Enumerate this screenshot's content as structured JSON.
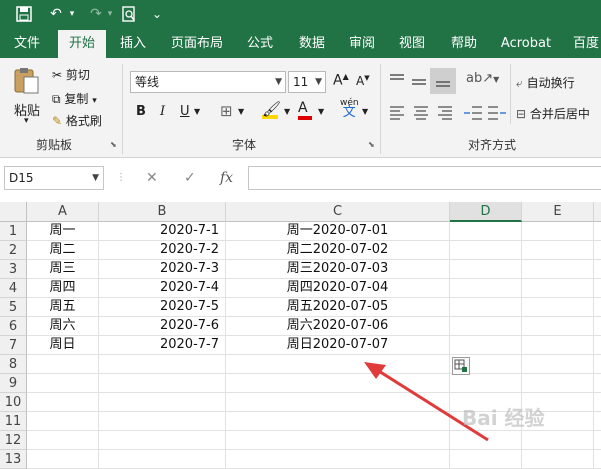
{
  "qat": {
    "undo": "↶",
    "redo": "↷",
    "save": "🖫",
    "preview": "🗋",
    "more": "⌄"
  },
  "tabs": [
    "文件",
    "开始",
    "插入",
    "页面布局",
    "公式",
    "数据",
    "审阅",
    "视图",
    "帮助",
    "Acrobat",
    "百度"
  ],
  "ribbon": {
    "clipboard": {
      "paste": "粘贴",
      "cut": "剪切",
      "copy": "复制",
      "format_painter": "格式刷",
      "label": "剪贴板"
    },
    "font": {
      "name": "等线",
      "size": "11",
      "bold": "B",
      "italic": "I",
      "underline": "U",
      "grow": "A",
      "shrink": "A",
      "label": "字体",
      "wen": "wén",
      "wen2": "文"
    },
    "align": {
      "wrap": "自动换行",
      "merge": "合并后居中",
      "label": "对齐方式"
    }
  },
  "formula_bar": {
    "name_box": "D15",
    "cancel": "✕",
    "enter": "✓",
    "fx": "fx",
    "value": ""
  },
  "columns": [
    "A",
    "B",
    "C",
    "D",
    "E"
  ],
  "selected_column": "D",
  "rows": [
    {
      "n": "1",
      "a": "周一",
      "b": "2020-7-1",
      "c": "周一2020-07-01"
    },
    {
      "n": "2",
      "a": "周二",
      "b": "2020-7-2",
      "c": "周二2020-07-02"
    },
    {
      "n": "3",
      "a": "周三",
      "b": "2020-7-3",
      "c": "周三2020-07-03"
    },
    {
      "n": "4",
      "a": "周四",
      "b": "2020-7-4",
      "c": "周四2020-07-04"
    },
    {
      "n": "5",
      "a": "周五",
      "b": "2020-7-5",
      "c": "周五2020-07-05"
    },
    {
      "n": "6",
      "a": "周六",
      "b": "2020-7-6",
      "c": "周六2020-07-06"
    },
    {
      "n": "7",
      "a": "周日",
      "b": "2020-7-7",
      "c": "周日2020-07-07"
    },
    {
      "n": "8",
      "a": "",
      "b": "",
      "c": ""
    },
    {
      "n": "9",
      "a": "",
      "b": "",
      "c": ""
    },
    {
      "n": "10",
      "a": "",
      "b": "",
      "c": ""
    },
    {
      "n": "11",
      "a": "",
      "b": "",
      "c": ""
    },
    {
      "n": "12",
      "a": "",
      "b": "",
      "c": ""
    },
    {
      "n": "13",
      "a": "",
      "b": "",
      "c": ""
    }
  ],
  "watermark": "Bai 经验",
  "colors": {
    "accent": "#217346",
    "arrow": "#e03a3a"
  }
}
